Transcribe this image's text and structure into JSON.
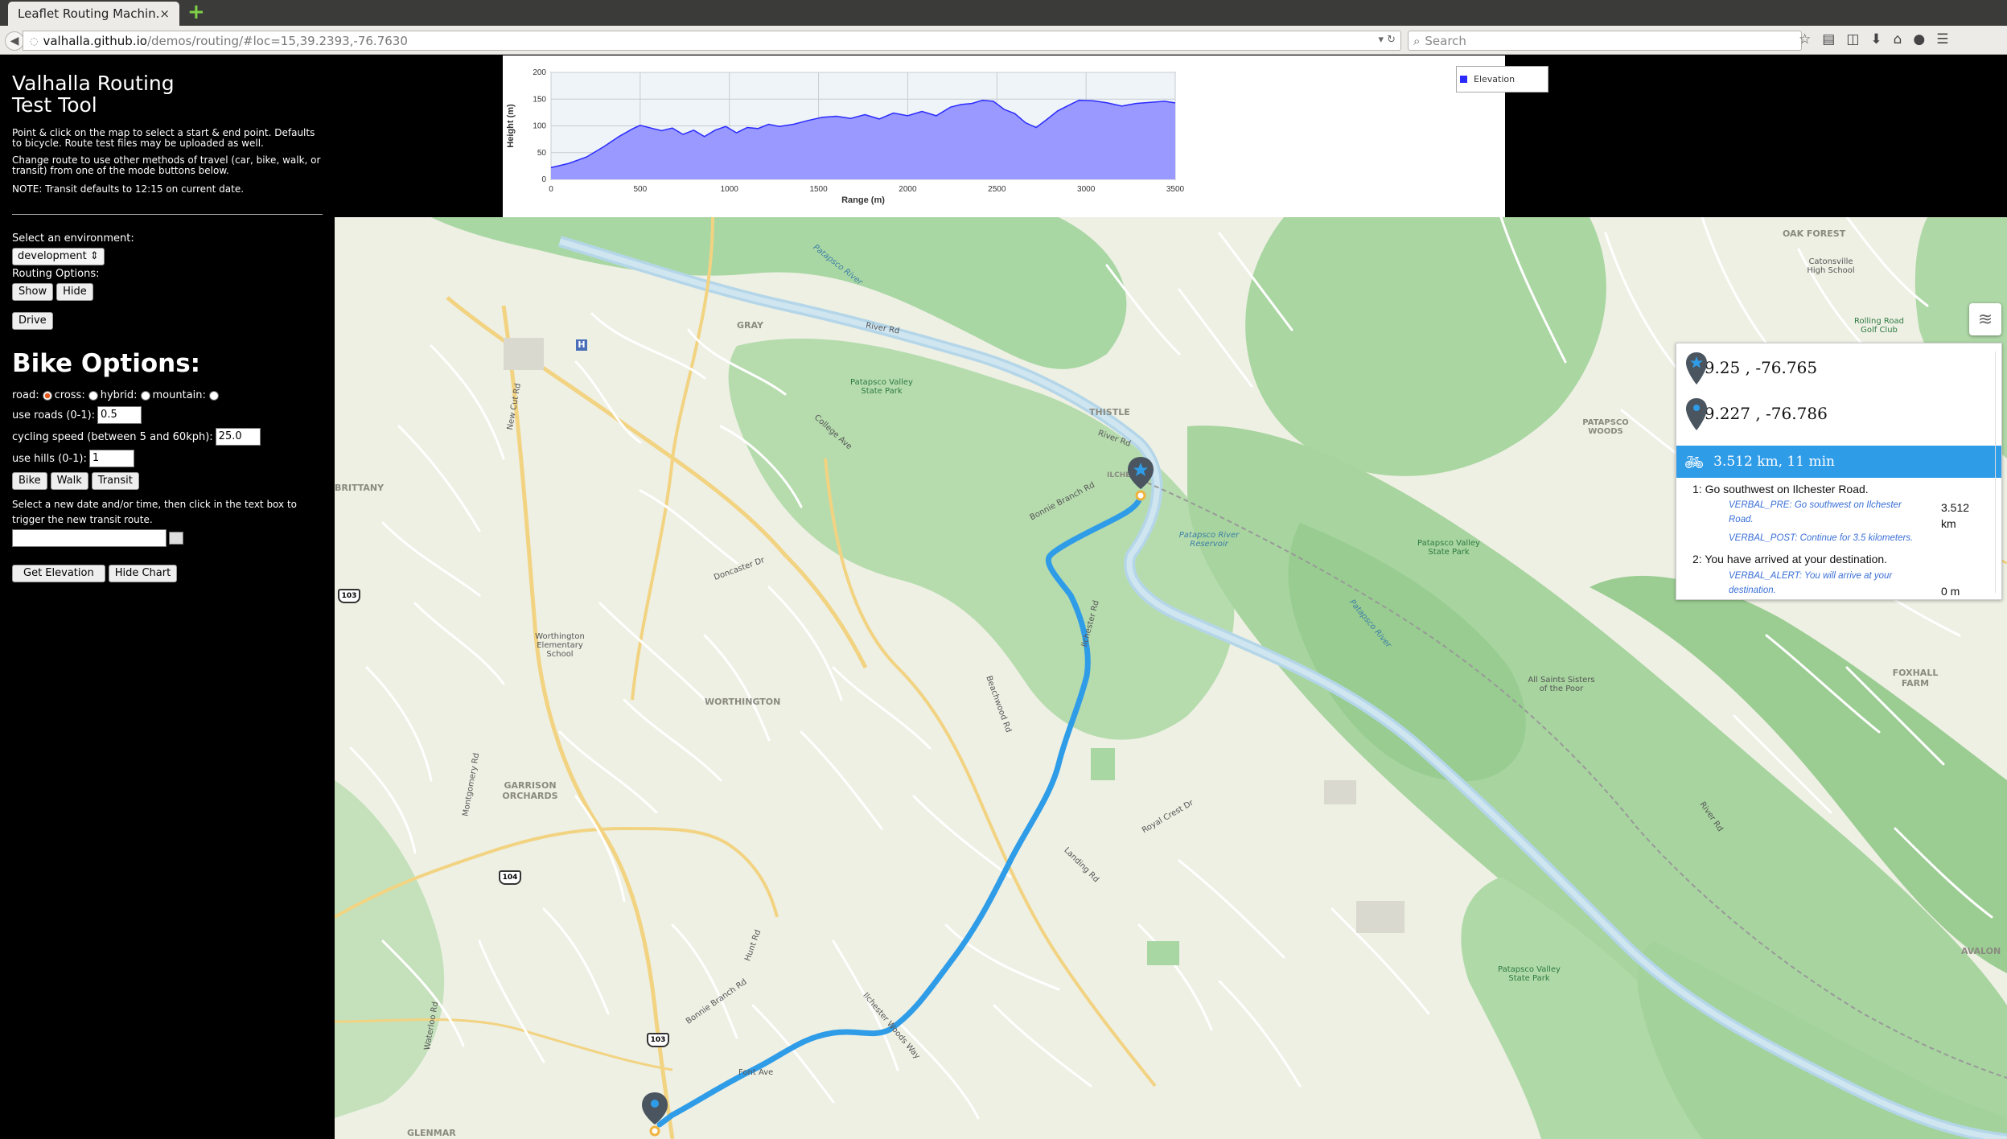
{
  "browser": {
    "tab_title": "Leaflet Routing Machin...",
    "tab_close": "×",
    "url_host": "valhalla.github.io",
    "url_path": "/demos/routing/#loc=15,39.2393,-76.7630",
    "search_placeholder": "Search"
  },
  "panel": {
    "title_line1": "Valhalla Routing",
    "title_line2": "Test Tool",
    "intro": "Point & click on the map to select a start & end point. Defaults to bicycle. Route test files may be uploaded as well.",
    "change_note": "Change route to use other methods of travel (car, bike, walk, or transit) from one of the mode buttons below.",
    "transit_note": "NOTE: Transit defaults to 12:15 on current date.",
    "env_label": "Select an environment:",
    "env_value": "development",
    "routing_options_label": "Routing Options:",
    "show_label": "Show",
    "hide_label": "Hide",
    "drive_label": "Drive",
    "bike_options_title": "Bike Options:",
    "road_label": "road:",
    "cross_label": "cross:",
    "hybrid_label": "hybrid:",
    "mountain_label": "mountain:",
    "use_roads_label": "use roads (0-1):",
    "use_roads_value": "0.5",
    "cycling_speed_label": "cycling speed (between 5 and 60kph):",
    "cycling_speed_value": "25.0",
    "use_hills_label": "use hills (0-1):",
    "use_hills_value": "1",
    "bike_label": "Bike",
    "walk_label": "Walk",
    "transit_label": "Transit",
    "date_note": "Select a new date and/or time, then click in the text box to trigger the new transit route.",
    "get_elevation_label": "Get Elevation",
    "hide_chart_label": "Hide Chart"
  },
  "chart_data": {
    "type": "area",
    "title": "",
    "xlabel": "Range (m)",
    "ylabel": "Height (m)",
    "xlim": [
      0,
      3500
    ],
    "ylim": [
      0,
      200
    ],
    "x_ticks": [
      0,
      500,
      1000,
      1500,
      2000,
      2500,
      3000,
      3500
    ],
    "y_ticks": [
      0,
      50,
      100,
      150,
      200
    ],
    "grid": true,
    "legend": "top-right",
    "colors": {
      "fill": "#9999ff",
      "stroke": "#2b2bff"
    },
    "series": [
      {
        "name": "Elevation",
        "x": [
          0,
          100,
          200,
          300,
          380,
          460,
          500,
          560,
          620,
          680,
          740,
          800,
          860,
          920,
          980,
          1040,
          1100,
          1160,
          1220,
          1280,
          1360,
          1440,
          1520,
          1600,
          1680,
          1760,
          1840,
          1920,
          2000,
          2080,
          2160,
          2240,
          2300,
          2360,
          2420,
          2480,
          2540,
          2600,
          2660,
          2720,
          2780,
          2840,
          2900,
          2960,
          3040,
          3120,
          3200,
          3280,
          3360,
          3440,
          3500
        ],
        "y": [
          22,
          30,
          42,
          62,
          80,
          95,
          101,
          96,
          91,
          96,
          84,
          92,
          80,
          92,
          99,
          87,
          97,
          95,
          103,
          99,
          103,
          110,
          116,
          118,
          114,
          121,
          113,
          124,
          119,
          127,
          119,
          135,
          140,
          142,
          148,
          146,
          131,
          123,
          106,
          97,
          112,
          128,
          138,
          148,
          147,
          143,
          137,
          142,
          144,
          146,
          143
        ]
      }
    ]
  },
  "map": {
    "labels": {
      "patapsco_river_top": "Patapsco River",
      "river_rd_1": "River Rd",
      "river_rd_2": "River Rd",
      "gray": "GRAY",
      "patapsco_state_park": "Patapsco Valley State Park",
      "college_ave": "College Ave",
      "thistle": "THISTLE",
      "ilchester": "ILCHESTER",
      "bonnie_branch_rd": "Bonnie Branch Rd",
      "oak_forest": "OAK FOREST",
      "catonsville_high": "Catonsville High School",
      "rolling_road_golf": "Rolling Road Golf Club",
      "patapsco_woods": "PATAPSCO WOODS",
      "patapsco_reservoir": "Patapsco River Reservoir",
      "patapsco_valley_sp2": "Patapsco Valley State Park",
      "patapsco_river_mid": "Patapsco River",
      "brittany": "BRITTANY",
      "new_cut_rd": "New Cut Rd",
      "doncaster_dr": "Doncaster Dr",
      "worthington_school": "Worthington Elementary School",
      "worthington": "WORTHINGTON",
      "beachwood_rd": "Beachwood Rd",
      "illchester_rd": "Ilchester Rd",
      "montgomery_rd": "Montgomery Rd",
      "garrison_orchards": "GARRISON ORCHARDS",
      "landing_rd": "Landing Rd",
      "all_saints": "All Saints Sisters of the Poor",
      "foxhall_farm": "FOXHALL FARM",
      "avalon": "AVALON",
      "patapsco_valley_sp3": "Patapsco Valley State Park",
      "glenmar": "GLENMAR",
      "river_rd_3": "River Rd",
      "ilchester_woods_way": "Ilchester Woods Way",
      "font_ave": "Font Ave",
      "hunt_rd": "Hunt Rd",
      "waterloo_rd": "Waterloo Rd",
      "royal_crest": "Royal Crest Dr",
      "bonnie_branch_2": "Bonnie Branch Rd"
    },
    "shields": {
      "s103a": "103",
      "s104": "104",
      "s103b": "103"
    },
    "hospital": "H"
  },
  "itinerary": {
    "start_coords": "39.25 , -76.765",
    "end_coords": "39.227 , -76.786",
    "summary": "3.512 km, 11 min",
    "step1": "1: Go southwest on Ilchester Road.",
    "step1_pre": "VERBAL_PRE: Go southwest on Ilchester Road.",
    "step1_post": "VERBAL_POST: Continue for 3.5 kilometers.",
    "step1_dist": "3.512 km",
    "step2": "2: You have arrived at your destination.",
    "step2_alert": "VERBAL_ALERT: You will arrive at your destination.",
    "step2_dist": "0 m"
  },
  "icons": {
    "star_pin": "star-marker-icon",
    "dot_pin": "destination-marker-icon",
    "bike": "bicycle-icon",
    "layers": "layers-icon"
  }
}
